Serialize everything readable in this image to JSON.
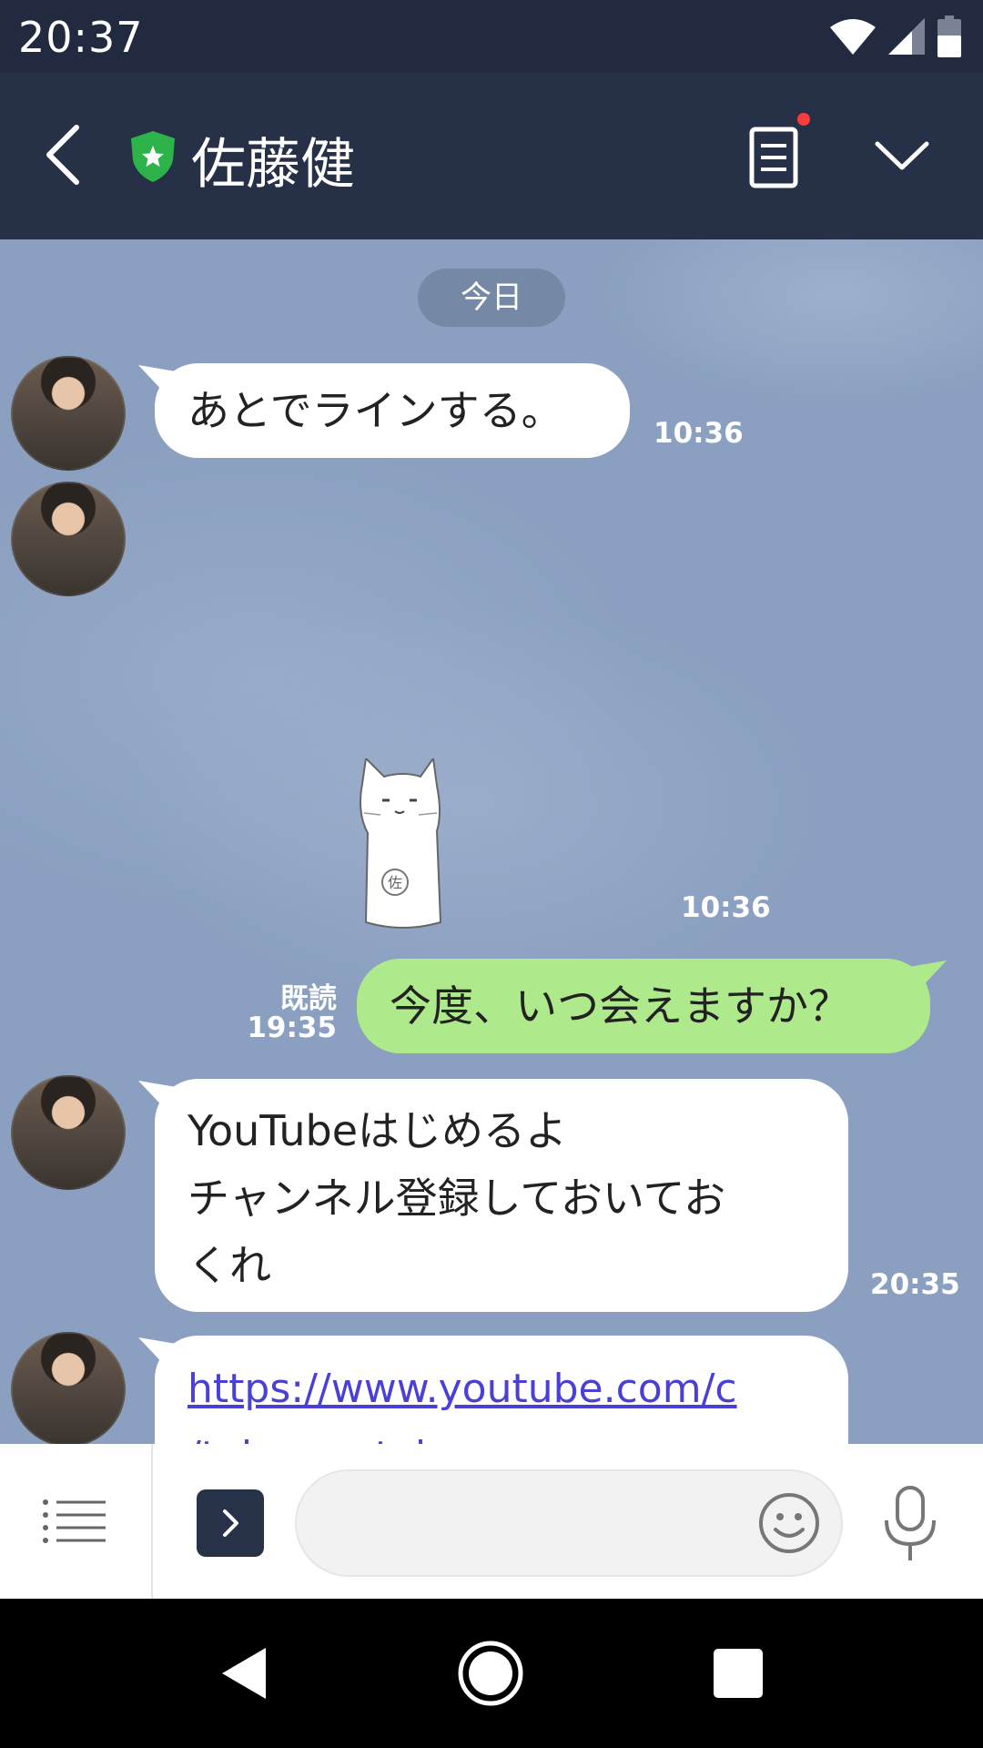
{
  "status_bar": {
    "time": "20:37"
  },
  "header": {
    "title": "佐藤健"
  },
  "chat": {
    "date_label": "今日",
    "messages": [
      {
        "from": "contact",
        "type": "text",
        "text": "あとでラインする。",
        "time": "10:36"
      },
      {
        "from": "contact",
        "type": "sticker",
        "sticker": "cat-sticker",
        "time": "10:36"
      },
      {
        "from": "me",
        "type": "text",
        "text": "今度、いつ会えますか？",
        "read_label": "既読",
        "time": "19:35"
      },
      {
        "from": "contact",
        "type": "text",
        "lines": [
          "YouTubeはじめるよ",
          "チャンネル登録しておいてお",
          "くれ"
        ],
        "time": "20:35"
      },
      {
        "from": "contact",
        "type": "link",
        "lines": [
          "https://www.youtube.com/c",
          "/takerusatoh"
        ]
      }
    ]
  },
  "input_bar": {
    "placeholder": ""
  },
  "colors": {
    "header_bg": "#263047",
    "chat_bg": "#8ba0c0",
    "outgoing_bubble": "#aee98b",
    "incoming_bubble": "#ffffff",
    "link": "#4a40d6",
    "shield": "#2db34a"
  },
  "icons": [
    "back-icon",
    "shield-star-icon",
    "notes-icon",
    "chevron-down-icon",
    "menu-icon",
    "chevron-right-icon",
    "smiley-icon",
    "microphone-icon",
    "wifi-icon",
    "signal-icon",
    "battery-icon"
  ]
}
